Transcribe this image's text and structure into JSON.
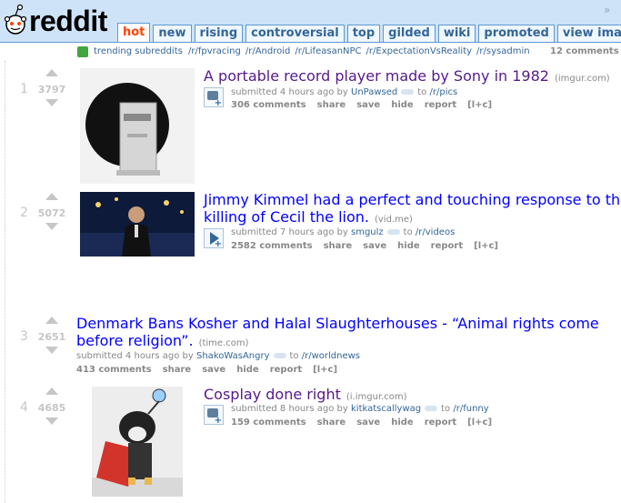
{
  "header": {
    "logo_text": "reddit",
    "tabs": [
      "hot",
      "new",
      "rising",
      "controversial",
      "top",
      "gilded",
      "wiki",
      "promoted",
      "view images"
    ],
    "selected_tab": "hot",
    "collapse_icon": "»"
  },
  "trending": {
    "label": "trending subreddits",
    "subreddits": [
      "/r/fpvracing",
      "/r/Android",
      "/r/LifeasanNPC",
      "/r/ExpectationVsReality",
      "/r/sysadmin"
    ],
    "comments": "12 comments"
  },
  "posts": [
    {
      "rank": "1",
      "score": "3797",
      "title": "A portable record player made by Sony in 1982",
      "domain": "(imgur.com)",
      "submitted": "submitted 4 hours ago by",
      "author": "UnPawsed",
      "to": "to",
      "subreddit": "/r/pics",
      "comments": "306 comments",
      "share": "share",
      "save": "save",
      "hide": "hide",
      "report": "report",
      "lc": "[l+c]"
    },
    {
      "rank": "2",
      "score": "5072",
      "title_line1": "Jimmy Kimmel had a perfect and touching response to th",
      "title_line2": "killing of Cecil the lion.",
      "domain": "(vid.me)",
      "submitted": "submitted 7 hours ago by",
      "author": "smgulz",
      "to": "to",
      "subreddit": "/r/videos",
      "comments": "2582 comments",
      "share": "share",
      "save": "save",
      "hide": "hide",
      "report": "report",
      "lc": "[l+c]"
    },
    {
      "rank": "3",
      "score": "2651",
      "title_line1": "Denmark Bans Kosher and Halal Slaughterhouses - “Animal rights come",
      "title_line2": "before religion”.",
      "domain": "(time.com)",
      "submitted": "submitted 4 hours ago by",
      "author": "ShakoWasAngry",
      "to": "to",
      "subreddit": "/r/worldnews",
      "comments": "413 comments",
      "share": "share",
      "save": "save",
      "hide": "hide",
      "report": "report",
      "lc": "[l+c]"
    },
    {
      "rank": "4",
      "score": "4685",
      "title": "Cosplay done right",
      "domain": "(i.imgur.com)",
      "submitted": "submitted 8 hours ago by",
      "author": "kitkatscallywag",
      "to": "to",
      "subreddit": "/r/funny",
      "comments": "159 comments",
      "share": "share",
      "save": "save",
      "hide": "hide",
      "report": "report",
      "lc": "[l+c]"
    }
  ]
}
